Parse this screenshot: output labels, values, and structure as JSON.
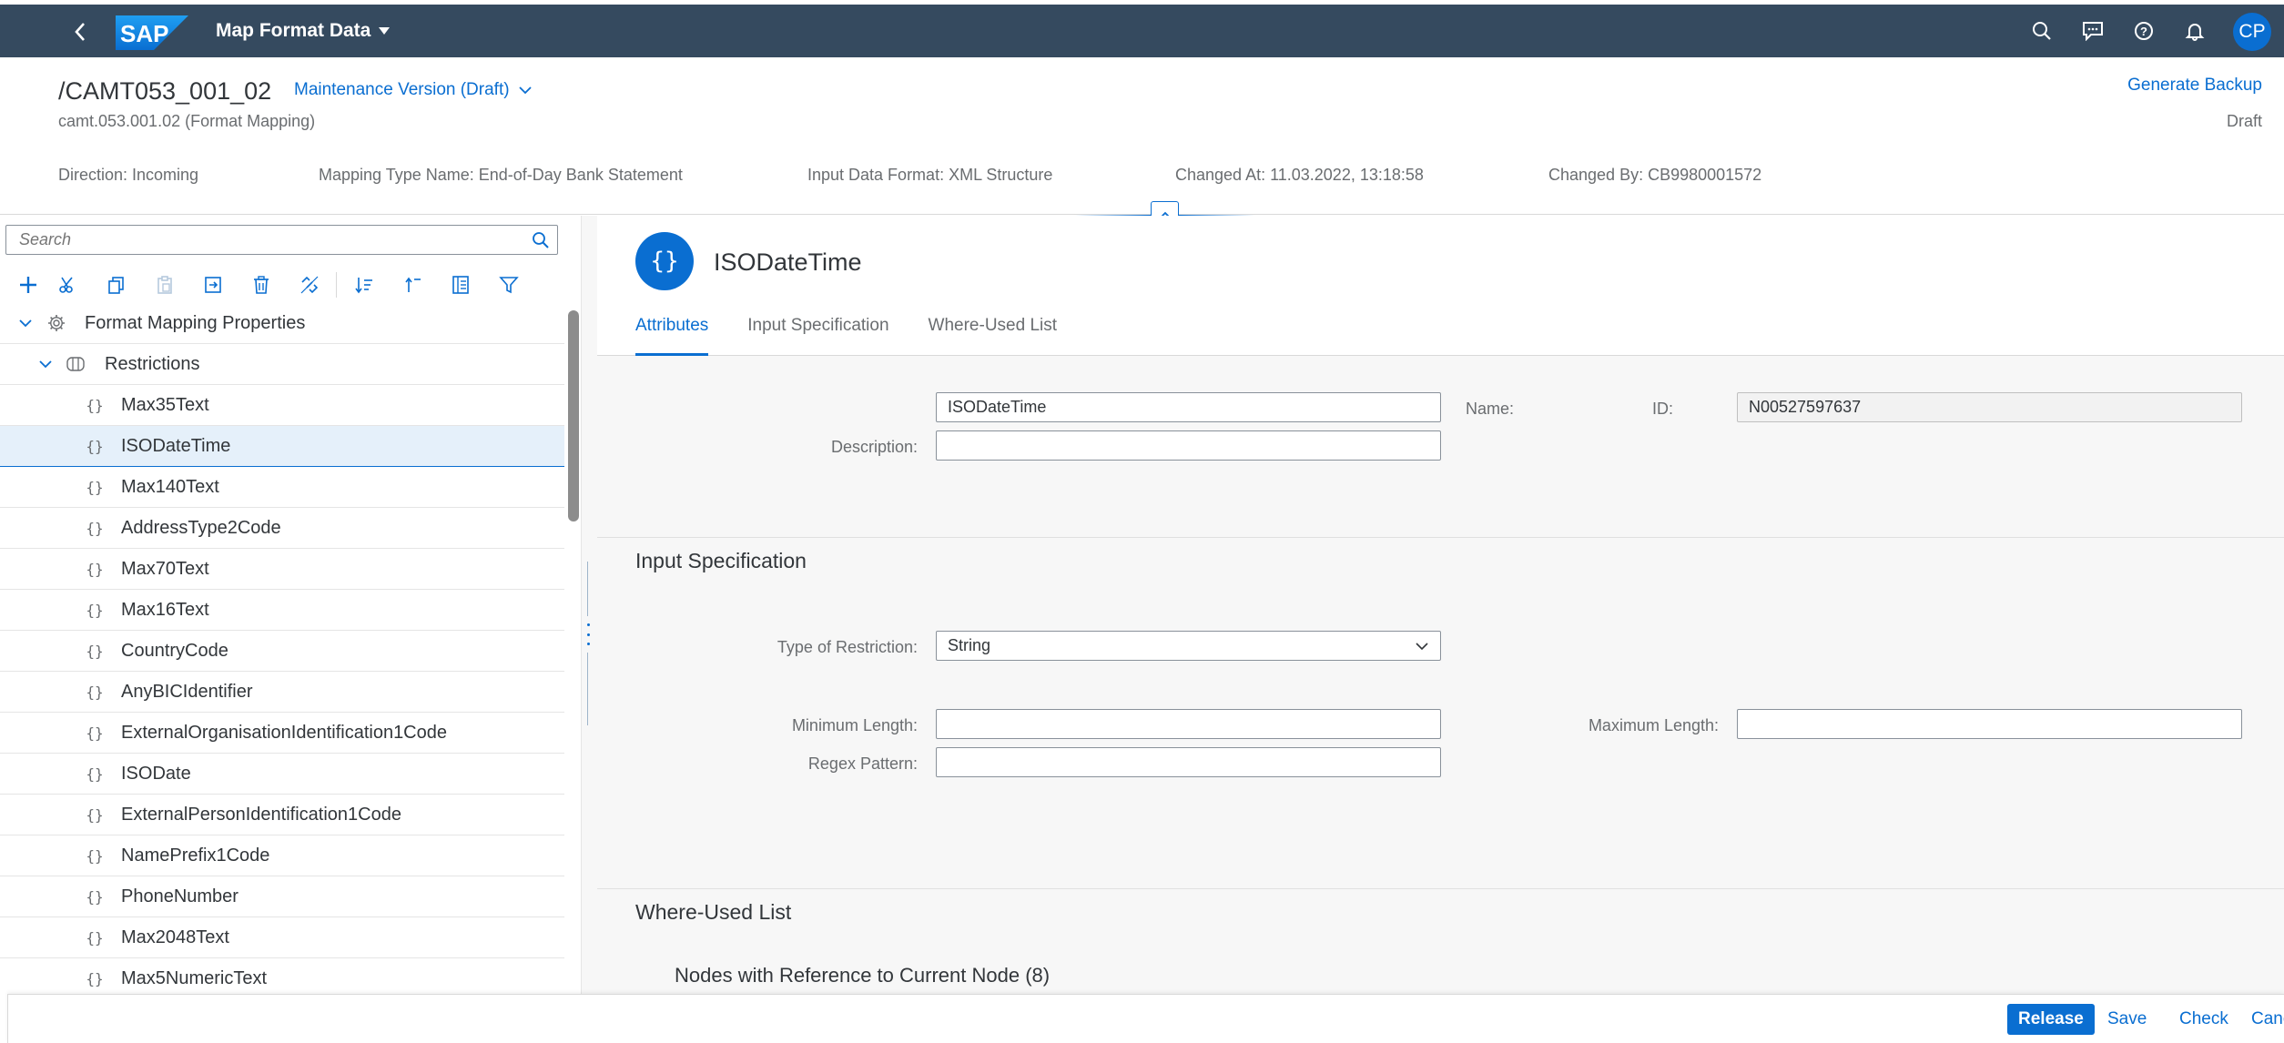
{
  "shell": {
    "app_title": "Map Format Data",
    "logo_text": "SAP",
    "avatar_initials": "CP"
  },
  "header": {
    "title": "/CAMT053_001_02",
    "variant": "Maintenance Version (Draft)",
    "subtitle": "camt.053.001.02 (Format Mapping)",
    "generate_backup": "Generate Backup",
    "status": "Draft",
    "attributes": [
      "Direction: Incoming",
      "Mapping Type Name: End-of-Day Bank Statement",
      "Input Data Format: XML Structure",
      "Changed At: 11.03.2022, 13:18:58",
      "Changed By: CB9980001572"
    ]
  },
  "tree": {
    "search_placeholder": "Search",
    "root": "Format Mapping Properties",
    "group": "Restrictions",
    "items": [
      "Max35Text",
      "ISODateTime",
      "Max140Text",
      "AddressType2Code",
      "Max70Text",
      "Max16Text",
      "CountryCode",
      "AnyBICIdentifier",
      "ExternalOrganisationIdentification1Code",
      "ISODate",
      "ExternalPersonIdentification1Code",
      "NamePrefix1Code",
      "PhoneNumber",
      "Max2048Text",
      "Max5NumericText"
    ],
    "selected_index": 1,
    "node_glyph": "{}"
  },
  "detail": {
    "icon_glyph": "{}",
    "title": "ISODateTime",
    "tabs": [
      "Attributes",
      "Input Specification",
      "Where-Used List"
    ],
    "attributes": {
      "name_label": "Name:",
      "name_value": "ISODateTime",
      "id_label": "ID:",
      "id_value": "N00527597637",
      "description_label": "Description:",
      "description_value": ""
    },
    "input_spec": {
      "title": "Input Specification",
      "type_label": "Type of Restriction:",
      "type_value": "String",
      "min_label": "Minimum Length:",
      "min_value": "",
      "max_label": "Maximum Length:",
      "max_value": "",
      "regex_label": "Regex Pattern:",
      "regex_value": ""
    },
    "where_used": {
      "title": "Where-Used List",
      "subtitle": "Nodes with Reference to Current Node (8)"
    }
  },
  "footer": {
    "release": "Release",
    "save": "Save",
    "check": "Check",
    "cancel": "Canc"
  },
  "colors": {
    "shell": "#354a5f",
    "accent": "#0a6ed1",
    "selection": "#e5f0fa"
  }
}
